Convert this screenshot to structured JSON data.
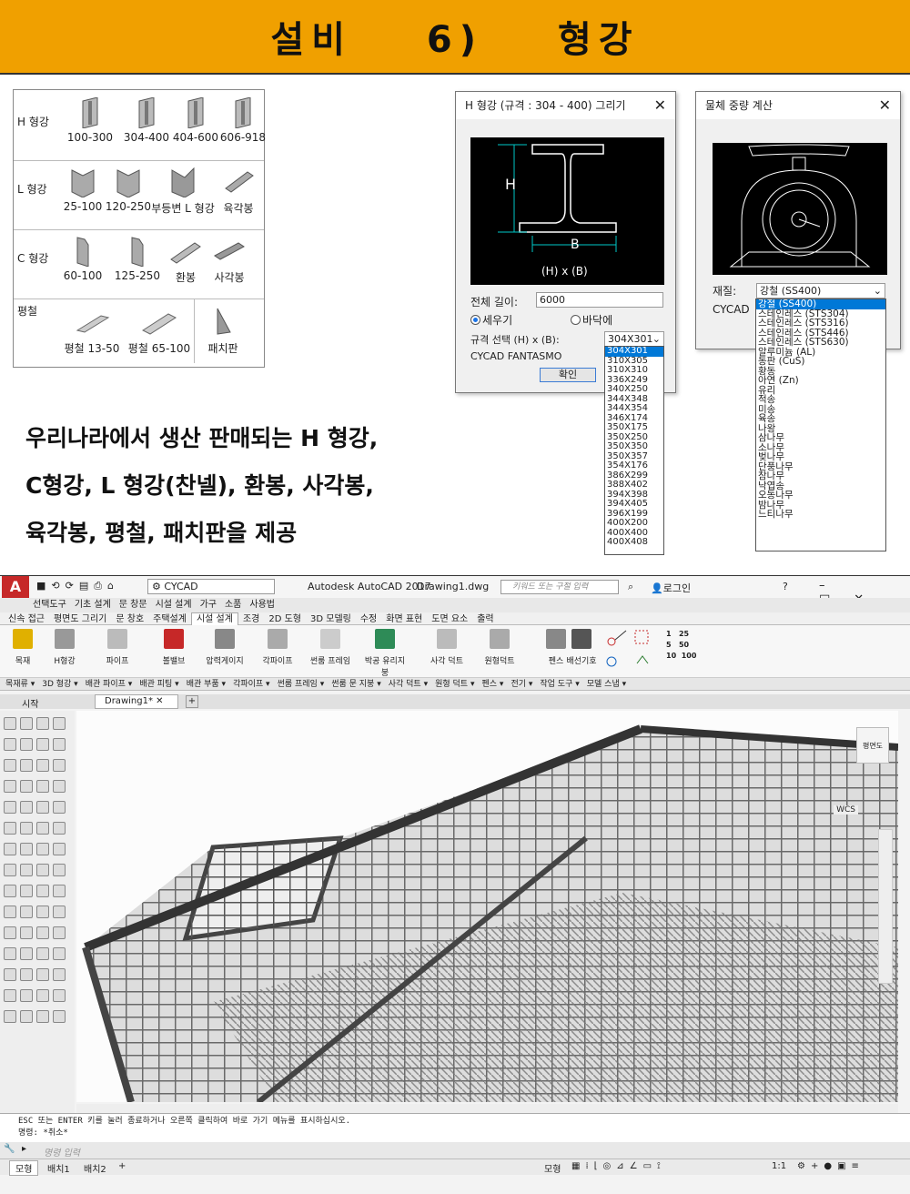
{
  "banner": {
    "title": "설비 6) 형강"
  },
  "catalog": {
    "rows": [
      {
        "label": "H 형강",
        "items": [
          "100-300",
          "304-400",
          "404-600",
          "606-918"
        ]
      },
      {
        "label": "L 형강",
        "items": [
          "25-100",
          "120-250",
          "부등변 L 형강",
          "육각봉"
        ]
      },
      {
        "label": "C 형강",
        "items": [
          "60-100",
          "125-250",
          "환봉",
          "사각봉"
        ]
      },
      {
        "label": "평철",
        "items": [
          "평철 13-50",
          "평철 65-100",
          "패치판"
        ]
      }
    ]
  },
  "hbeam_dialog": {
    "title": "H 형강 (규격 : 304 - 400) 그리기",
    "close": "✕",
    "canvas_h": "H",
    "canvas_b": "B",
    "canvas_formula": "(H) x (B)",
    "length_label": "전체 길이:",
    "length_value": "6000",
    "radio_upright": "세우기",
    "radio_floor": "바닥에",
    "spec_label": "규격 선택 (H) x (B):",
    "spec_selected": "304X301",
    "brand": "CYCAD FANTASMO",
    "ok": "확인",
    "spec_options": [
      "304X301",
      "310X305",
      "310X310",
      "336X249",
      "340X250",
      "344X348",
      "344X354",
      "346X174",
      "350X175",
      "350X250",
      "350X350",
      "350X357",
      "354X176",
      "386X299",
      "388X402",
      "394X398",
      "394X405",
      "396X199",
      "400X200",
      "400X400",
      "400X408"
    ]
  },
  "weight_dialog": {
    "title": "물체 중량 계산",
    "close": "✕",
    "material_label": "재질:",
    "material_selected": "강철 (SS400)",
    "brand": "CYCAD",
    "material_options": [
      "강철 (SS400)",
      "스테인레스 (STS304)",
      "스테인레스 (STS316)",
      "스테인레스 (STS446)",
      "스테인레스 (STS630)",
      "알루미늄 (AL)",
      "동판 (CuS)",
      "황동",
      "아연 (Zn)",
      "유리",
      "적송",
      "미송",
      "육송",
      "나왕",
      "삼나무",
      "소나무",
      "벚나무",
      "단풍나무",
      "참나무",
      "낙엽송",
      "오동나무",
      "밤나무",
      "느티나무"
    ]
  },
  "description": {
    "line1": "우리나라에서 생산 판매되는 H 형강,",
    "line2": "C형강, L 형강(찬넬), 환봉, 사각봉,",
    "line3": "육각봉, 평철, 패치판을 제공"
  },
  "autocad": {
    "app_title": "Autodesk AutoCAD 2017",
    "doc_title": "Drawing1.dwg",
    "workspace": "CYCAD",
    "search_placeholder": "키워드 또는 구절 입력",
    "login": "로그인",
    "menu": [
      "선택도구",
      "기초 설계",
      "문 창문",
      "시설 설계",
      "가구",
      "소품",
      "사용법"
    ],
    "tabs": [
      "신속 접근",
      "평면도 그리기",
      "문 창호",
      "주택설계",
      "시설 설계",
      "조경",
      "2D 도형",
      "3D 모델링",
      "수정",
      "화면 표현",
      "도면 요소",
      "출력"
    ],
    "active_tab": "시설 설계",
    "ribbon_buttons": [
      "목재",
      "H형강",
      "파이프",
      "볼밸브",
      "압력게이지",
      "각파이프",
      "썬룸 프레임",
      "박공 유리지붕",
      "사각 덕트",
      "원형덕트",
      "펜스",
      "배선기호"
    ],
    "scale_buttons": [
      "1",
      "25",
      "5",
      "50",
      "10",
      "100"
    ],
    "panels": [
      "목재류 ▾",
      "3D 형강 ▾",
      "배관 파이프 ▾",
      "배관 피팅 ▾",
      "배관 부품 ▾",
      "각파이프 ▾",
      "썬룸 프레임 ▾",
      "썬룸 문 지붕 ▾",
      "사각 덕트 ▾",
      "원형 덕트 ▾",
      "펜스 ▾",
      "전기 ▾",
      "작업 도구 ▾",
      "모델 스냅 ▾"
    ],
    "file_tabs": [
      "시작",
      "Drawing1*"
    ],
    "viewcube_label": "평면도",
    "wcs": "WCS",
    "command_history": "ESC 또는 ENTER 키를 눌러 종료하거나 오른쪽 클릭하여 바로 가기 메뉴를 표시하십시오.",
    "command_last": "명령: *취소*",
    "command_placeholder": "명령 입력",
    "layout_tabs": [
      "모형",
      "배치1",
      "배치2"
    ],
    "status_model": "모형",
    "status_scale": "1:1"
  }
}
